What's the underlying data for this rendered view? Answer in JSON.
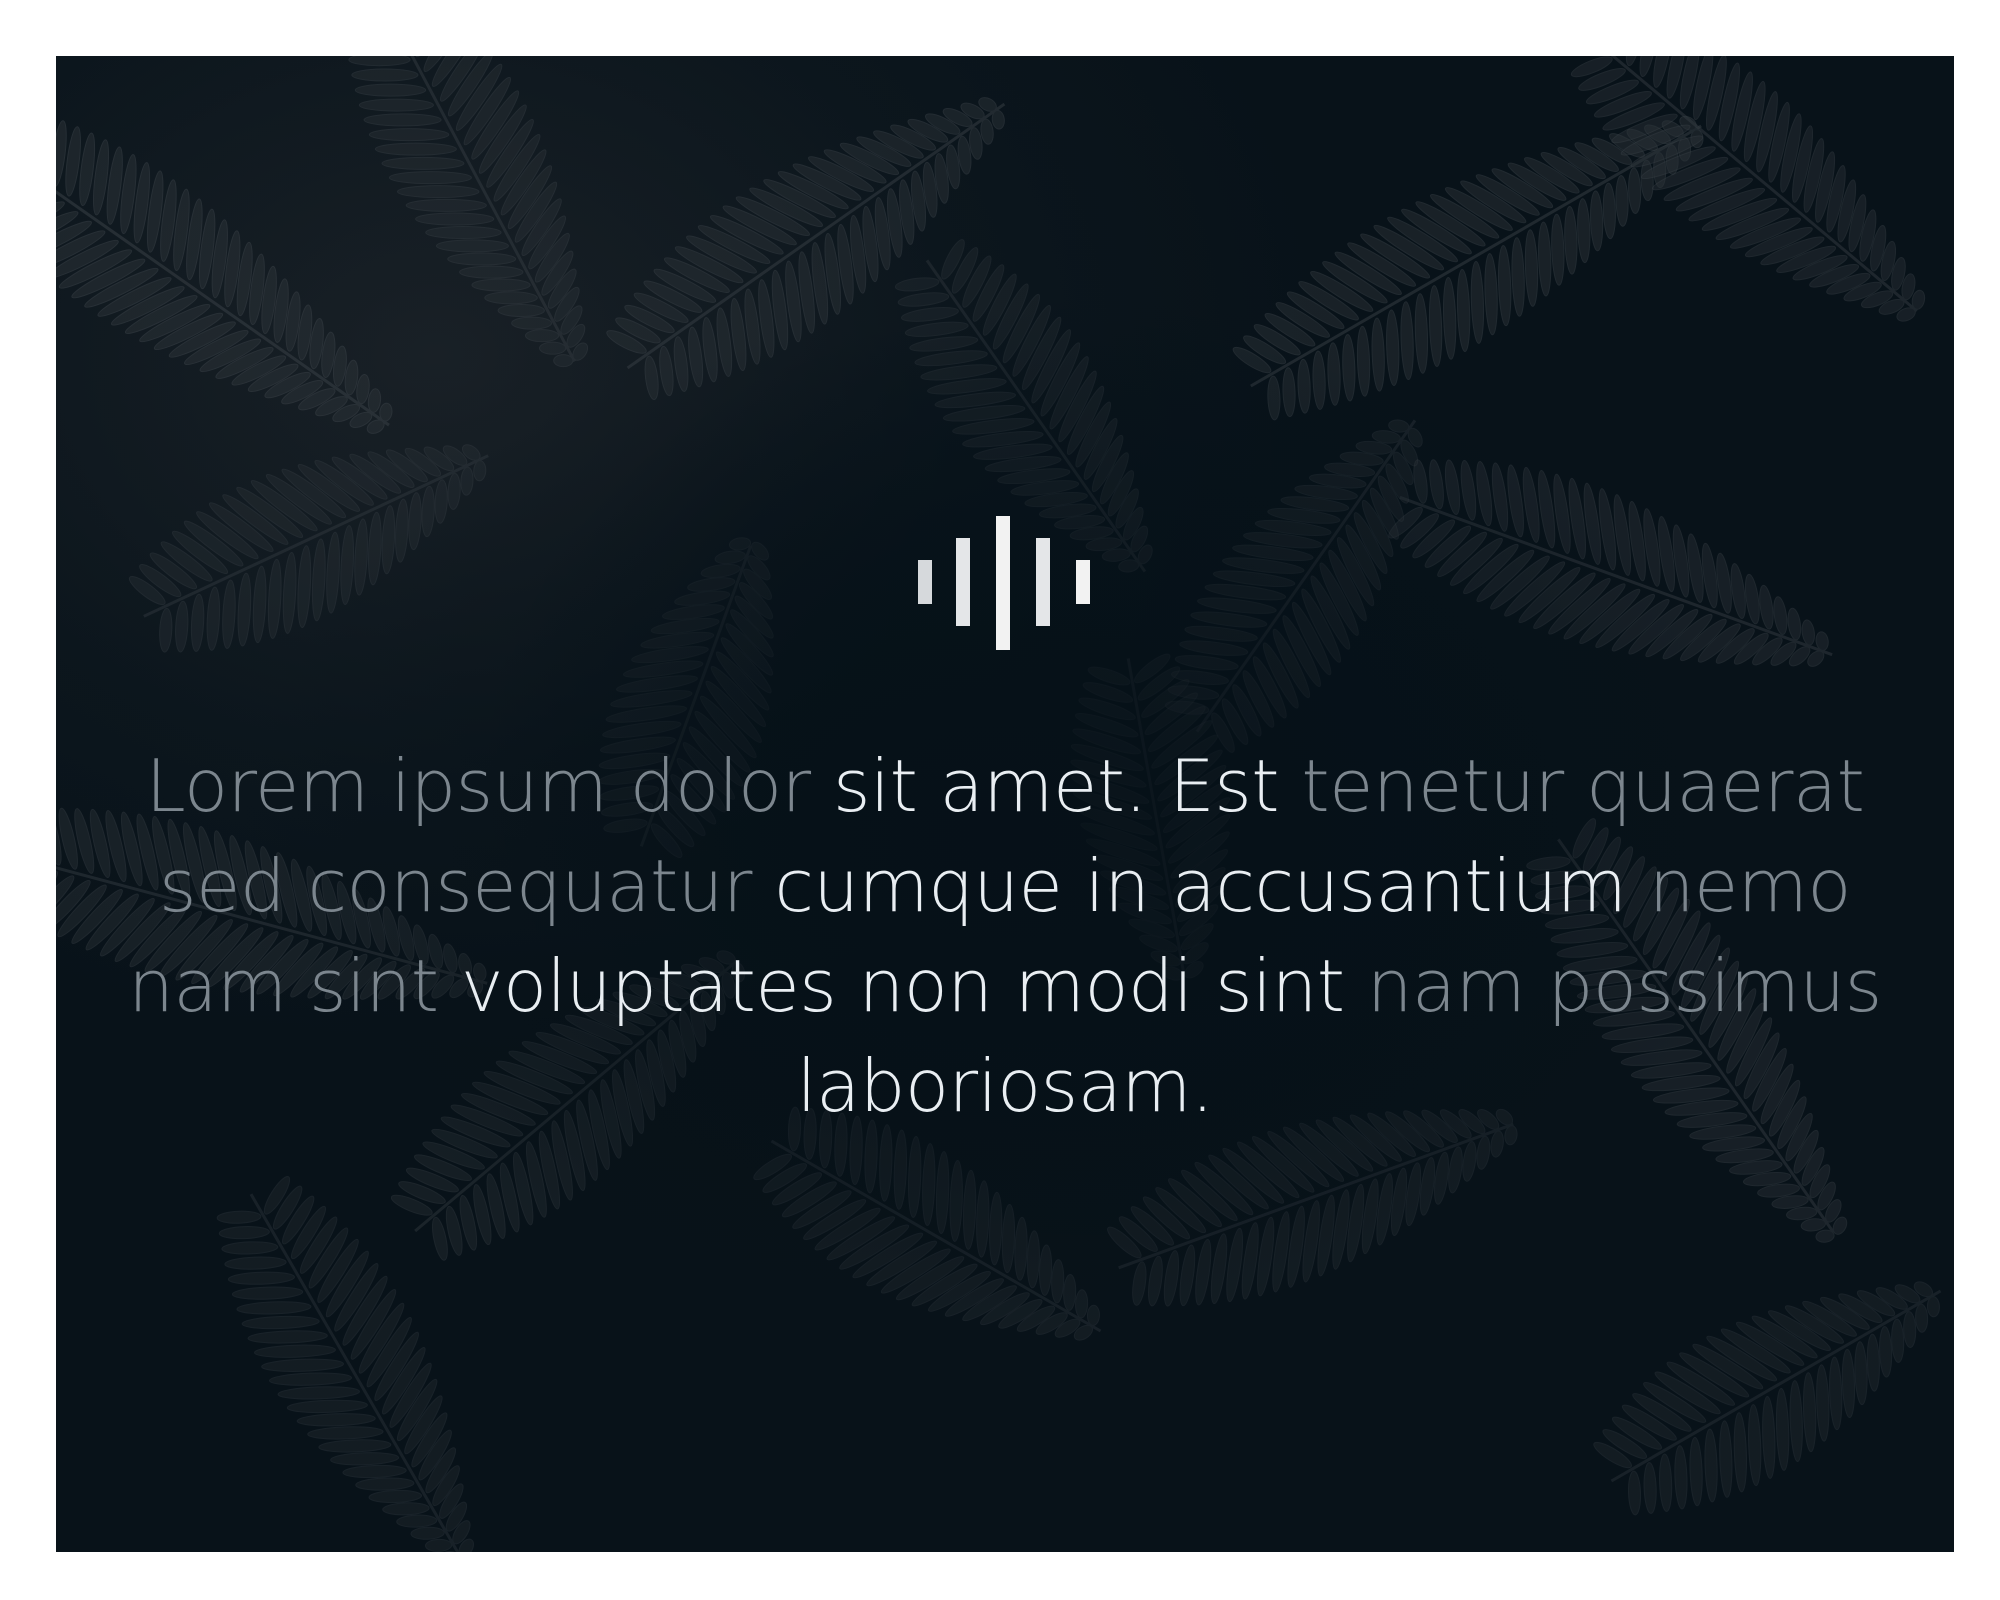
{
  "hero": {
    "logo_icon": "soundwave-icon",
    "background": "dark-fern-photo",
    "quote_segments": [
      {
        "text": "Lorem ipsum dolor ",
        "tone": "faded"
      },
      {
        "text": "sit amet. Est ",
        "tone": "bright"
      },
      {
        "text": "tenetur quaerat",
        "tone": "faded"
      },
      {
        "text": " sed consequatur ",
        "tone": "faded"
      },
      {
        "text": "cumque in accusantium ",
        "tone": "bright"
      },
      {
        "text": "nemo nam sint ",
        "tone": "faded"
      },
      {
        "text": "voluptates non modi sint ",
        "tone": "bright"
      },
      {
        "text": "nam possimus",
        "tone": "faded"
      },
      {
        "text": " laboriosam.",
        "tone": "bright"
      }
    ]
  },
  "colors": {
    "background": "#0a141b",
    "text_bright": "#e9eef2",
    "text_faded": "#7c868e",
    "logo": "#f2f2f2"
  }
}
